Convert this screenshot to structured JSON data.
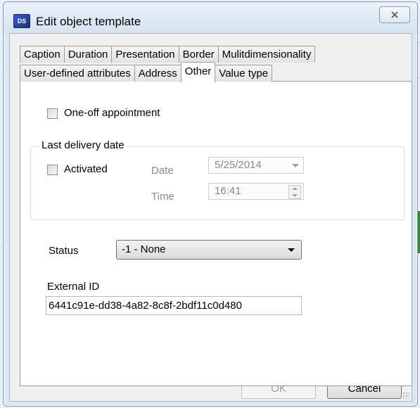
{
  "window": {
    "title": "Edit object template",
    "icon": "app-icon"
  },
  "tabs": {
    "row1": [
      "Caption",
      "Duration",
      "Presentation",
      "Border",
      "Mulitdimensionality"
    ],
    "row2": [
      "User-defined attributes",
      "Address",
      "Other",
      "Value type"
    ],
    "active": "Other"
  },
  "other": {
    "one_off_label": "One-off appointment",
    "one_off_checked": false,
    "last_delivery": {
      "title": "Last delivery date",
      "activated_label": "Activated",
      "activated_checked": false,
      "date_label": "Date",
      "date_value": "5/25/2014",
      "time_label": "Time",
      "time_value": "16:41"
    },
    "status_label": "Status",
    "status_value": "-1 - None",
    "external_id_label": "External ID",
    "external_id_value": "6441c91e-dd38-4a82-8c8f-2bdf11c0d480"
  },
  "buttons": {
    "ok": "OK",
    "cancel": "Cancel"
  },
  "colors": {
    "dialog_bg": "#f0f0f0",
    "tab_page_bg": "#ffffff",
    "titlebar": "#dbe7f3"
  }
}
